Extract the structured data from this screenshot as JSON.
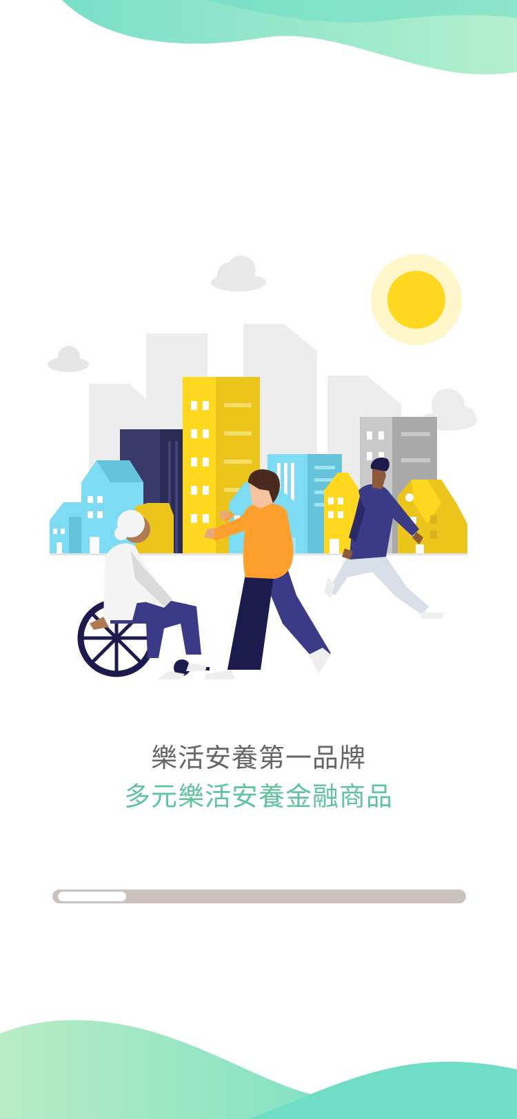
{
  "splash": {
    "headline": "樂活安養第一品牌",
    "subline": "多元樂活安養金融商品"
  },
  "progress": {
    "value": 0.17
  },
  "colors": {
    "headline": "#666666",
    "subline": "#5fc39e",
    "wave_start": "#b8ecc4",
    "wave_end": "#62dcc4",
    "progress_track": "#cbc1bd",
    "progress_fill": "#ffffff",
    "sun": "#ffd81f"
  },
  "icons": {
    "illustration": "city-people-illustration"
  }
}
